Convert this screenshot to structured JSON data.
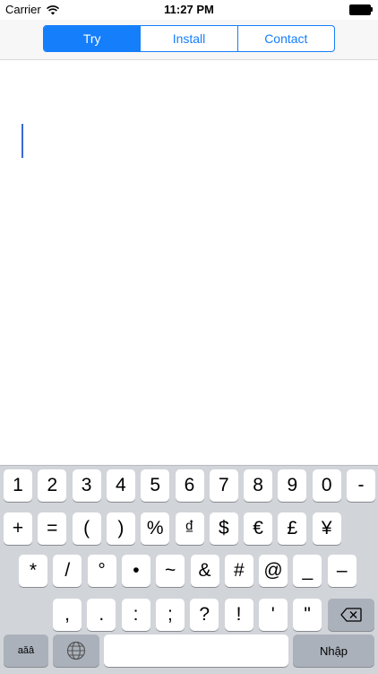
{
  "status_bar": {
    "carrier": "Carrier",
    "time": "11:27 PM",
    "icons": [
      "wifi-icon",
      "battery-icon"
    ]
  },
  "segmented_control": {
    "accent": "#157efb",
    "selected": "Try",
    "segments": [
      "Try",
      "Install",
      "Contact"
    ]
  },
  "editor": {
    "text": "",
    "caret_color": "#3b67d8"
  },
  "keyboard": {
    "row1": [
      "1",
      "2",
      "3",
      "4",
      "5",
      "6",
      "7",
      "8",
      "9",
      "0",
      "-"
    ],
    "row2": [
      "+",
      "=",
      "(",
      ")",
      "%",
      "₫",
      "$",
      "€",
      "£",
      "¥"
    ],
    "row3": [
      "*",
      "/",
      "°",
      "•",
      "~",
      "&",
      "#",
      "@",
      "_",
      "–"
    ],
    "row4": [
      ",",
      ".",
      ":",
      ";",
      "?",
      "!",
      "'",
      "\""
    ],
    "mode_key": "aăâ",
    "return_key": "Nhập",
    "icons": [
      "globe-icon",
      "backspace-icon"
    ]
  }
}
